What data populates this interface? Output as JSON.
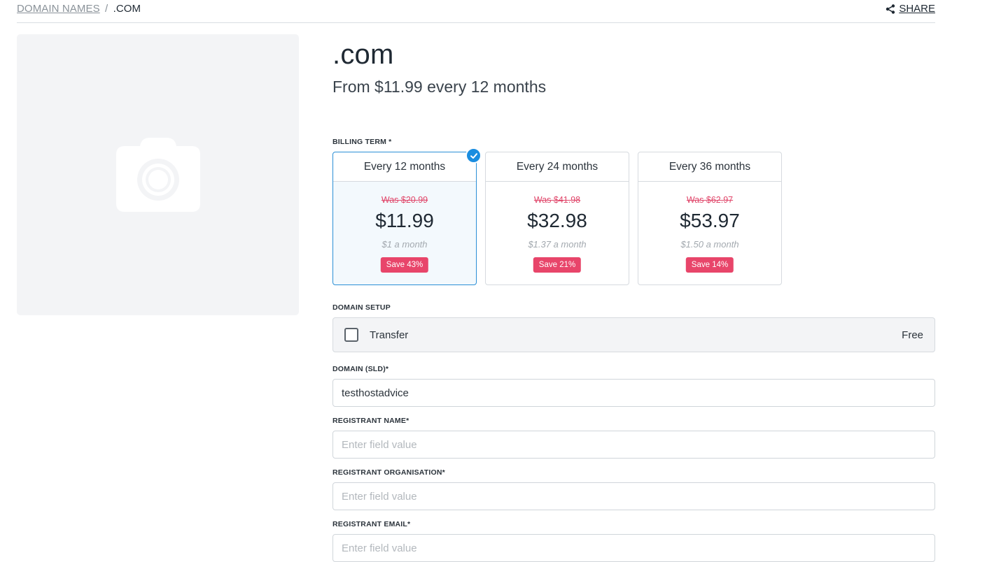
{
  "breadcrumb": {
    "parent": "DOMAIN NAMES",
    "separator": "/",
    "current": ".COM"
  },
  "share": {
    "label": "SHARE",
    "icon": "share-icon"
  },
  "product": {
    "image_icon": "camera-icon",
    "title": ".com",
    "subtitle": "From $11.99 every 12 months"
  },
  "billing": {
    "label": "BILLING TERM *",
    "terms": [
      {
        "name": "Every 12 months",
        "was": "Was $20.99",
        "price": "$11.99",
        "monthly": "$1 a month",
        "save": "Save 43%",
        "selected": true
      },
      {
        "name": "Every 24 months",
        "was": "Was $41.98",
        "price": "$32.98",
        "monthly": "$1.37 a month",
        "save": "Save 21%",
        "selected": false
      },
      {
        "name": "Every 36 months",
        "was": "Was $62.97",
        "price": "$53.97",
        "monthly": "$1.50 a month",
        "save": "Save 14%",
        "selected": false
      }
    ]
  },
  "setup": {
    "label": "DOMAIN SETUP",
    "option": "Transfer",
    "option_price": "Free",
    "checked": false
  },
  "fields": {
    "sld": {
      "label": "DOMAIN (SLD)*",
      "value": "testhostadvice",
      "placeholder": ""
    },
    "registrant_name": {
      "label": "REGISTRANT NAME*",
      "value": "",
      "placeholder": "Enter field value"
    },
    "registrant_org": {
      "label": "REGISTRANT ORGANISATION*",
      "value": "",
      "placeholder": "Enter field value"
    },
    "registrant_email": {
      "label": "REGISTRANT EMAIL*",
      "value": "",
      "placeholder": "Enter field value"
    }
  },
  "colors": {
    "accent": "#1a8de0",
    "sale": "#e8456a",
    "placeholder_bg": "#f3f4f6"
  }
}
